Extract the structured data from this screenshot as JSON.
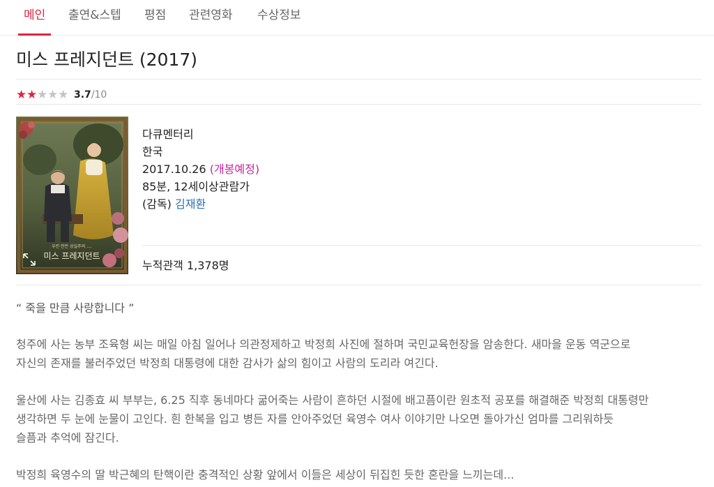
{
  "tabs": [
    {
      "label": "메인",
      "active": true
    },
    {
      "label": "출연&스텝",
      "active": false
    },
    {
      "label": "평점",
      "active": false
    },
    {
      "label": "관련영화",
      "active": false
    },
    {
      "label": "수상정보",
      "active": false
    }
  ],
  "movie": {
    "title": "미스 프레지던트 (2017)",
    "rating": {
      "stars_filled": 2,
      "stars_total": 5,
      "score": "3.7",
      "max": "/10"
    },
    "genre": "다큐멘터리",
    "country": "한국",
    "release_date": "2017.10.26",
    "release_badge": "(개봉예정)",
    "runtime_rating": "85분, 12세이상관람가",
    "director_label": "(감독)",
    "director": "김재환",
    "audience": "누적관객 1,378명"
  },
  "poster": {
    "caption_small": "우린 만든 상실주의 ....",
    "caption_title": "미스 프레지던트"
  },
  "synopsis": {
    "tagline": "“ 죽을 만큼 사랑합니다 ”",
    "paragraphs": [
      {
        "lines": [
          "청주에 사는 농부 조육형 씨는 매일 아침 일어나 의관정제하고 박정희 사진에 절하며 국민교육헌장을 암송한다. 새마을 운동 역군으로",
          "자신의 존재를 불러주었던 박정희 대통령에 대한 감사가 삶의 힘이고 사람의 도리라 여긴다."
        ]
      },
      {
        "lines": [
          "울산에 사는 김종효 씨 부부는, 6.25 직후 동네마다 굶어죽는 사람이 흔하던 시절에 배고픔이란 원초적 공포를 해결해준 박정희 대통령만",
          "생각하면 두 눈에 눈물이 고인다. 흰 한복을 입고 병든 자를 안아주었던 육영수 여사 이야기만 나오면 돌아가신 엄마를 그리워하듯",
          "슬픔과 추억에 잠긴다."
        ]
      },
      {
        "lines": [
          "박정희 육영수의 딸 박근혜의 탄핵이란 충격적인 상황 앞에서 이들은 세상이 뒤집힌 듯한 혼란을 느끼는데..."
        ]
      }
    ]
  },
  "colors": {
    "accent": "#e2233f",
    "badge": "#c0289b",
    "link": "#2a6fb8"
  },
  "icons": {
    "star": "star-icon",
    "expand": "expand-icon"
  }
}
